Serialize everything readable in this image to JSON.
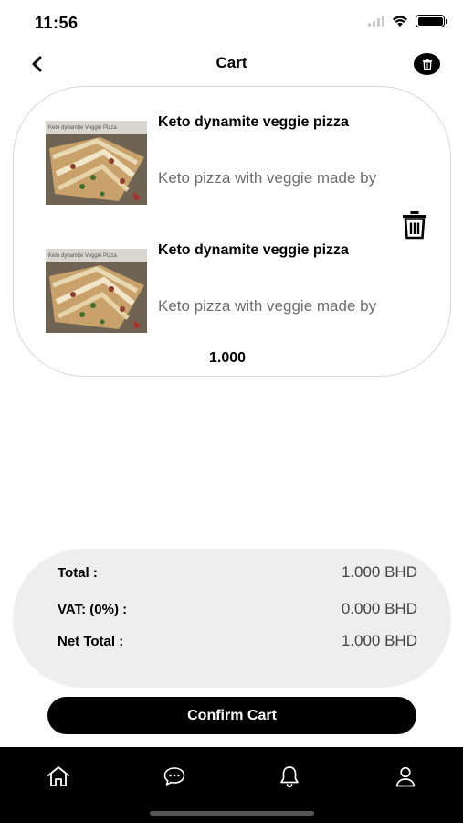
{
  "status_bar": {
    "time": "11:56",
    "icons": [
      "cellular-signal-icon",
      "wifi-icon",
      "battery-icon"
    ]
  },
  "header": {
    "title": "Cart",
    "back_icon": "chevron-left-icon",
    "clear_icon": "trash-icon"
  },
  "cart": {
    "items": [
      {
        "name": "Keto dynamite veggie pizza",
        "description": "Keto pizza with veggie made by",
        "image": "pizza-photo"
      },
      {
        "name": "Keto dynamite veggie pizza",
        "description": "Keto pizza with veggie made by",
        "image": "pizza-photo"
      }
    ],
    "price": "1.000",
    "delete_icon": "trash-icon"
  },
  "summary": {
    "total_label": "Total :",
    "total_value": "1.000 BHD",
    "vat_label": "VAT: (0%) :",
    "vat_value": "0.000 BHD",
    "net_label": "Net Total :",
    "net_value": "1.000 BHD"
  },
  "confirm_label": "Confirm Cart",
  "tab_bar": {
    "icons": [
      "home-icon",
      "chat-icon",
      "bell-icon",
      "profile-icon"
    ]
  },
  "colors": {
    "primary": "#000000",
    "summary_bg": "#eeeeee",
    "card_border": "#d7d7d7",
    "muted_text": "#6e6e6e"
  }
}
